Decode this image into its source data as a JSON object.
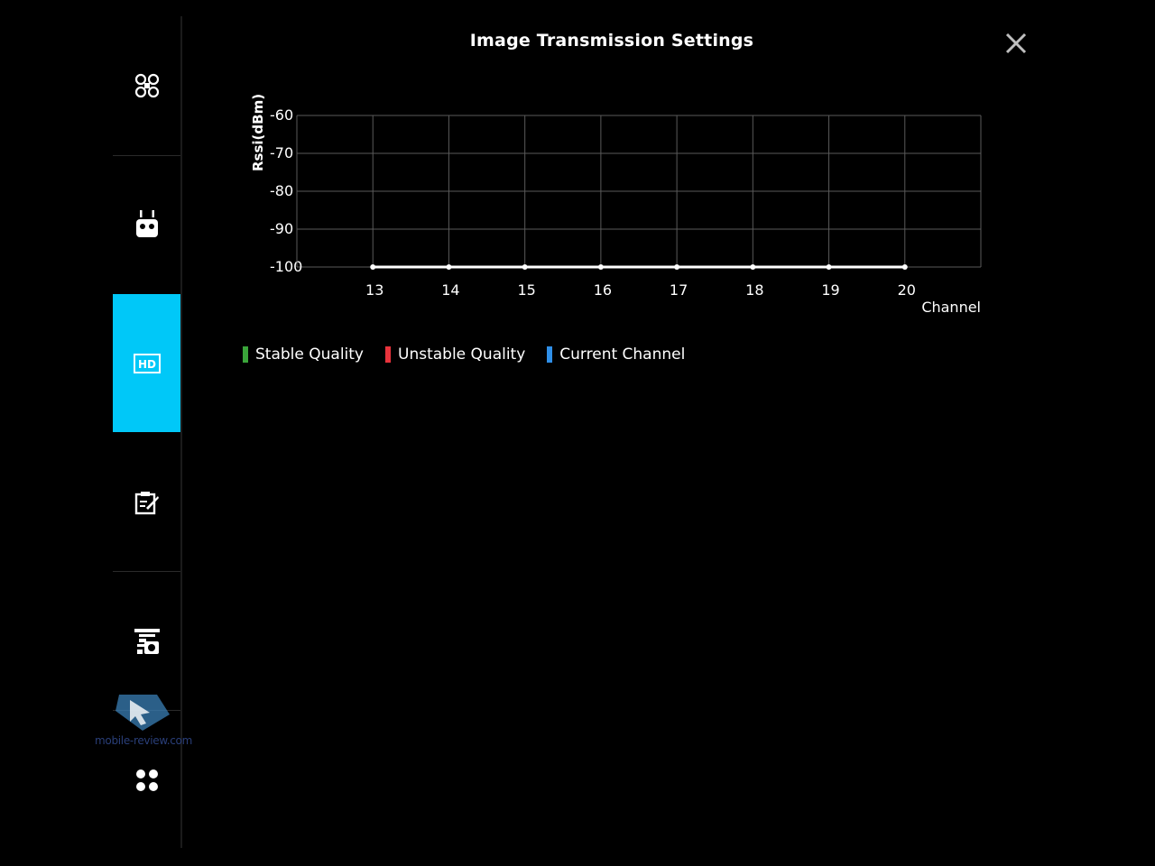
{
  "header": {
    "title": "Image Transmission Settings"
  },
  "sidebar": {
    "items": [
      {
        "icon": "aircraft-icon",
        "active": false
      },
      {
        "icon": "remote-controller-icon",
        "active": false
      },
      {
        "icon": "hd-transmission-icon",
        "active": true
      },
      {
        "icon": "checklist-icon",
        "active": false
      },
      {
        "icon": "gimbal-camera-icon",
        "active": false
      },
      {
        "icon": "more-dots-icon",
        "active": false
      }
    ],
    "active_color": "#00c8f8"
  },
  "chart_data": {
    "type": "line",
    "ylabel": "Rssi(dBm)",
    "xlabel": "Channel",
    "ylim": [
      -100,
      -60
    ],
    "yticks": [
      "-60",
      "-70",
      "-80",
      "-90",
      "-100"
    ],
    "x": [
      "13",
      "14",
      "15",
      "16",
      "17",
      "18",
      "19",
      "20"
    ],
    "series": [
      {
        "values": [
          -100,
          -100,
          -100,
          -100,
          -100,
          -100,
          -100,
          -100
        ]
      }
    ],
    "grid": true
  },
  "legend": [
    {
      "label": "Stable Quality",
      "color": "#3aa53a"
    },
    {
      "label": "Unstable Quality",
      "color": "#e8333c"
    },
    {
      "label": "Current Channel",
      "color": "#2f8fe8"
    }
  ],
  "watermark": {
    "text": "mobile-review.com"
  }
}
